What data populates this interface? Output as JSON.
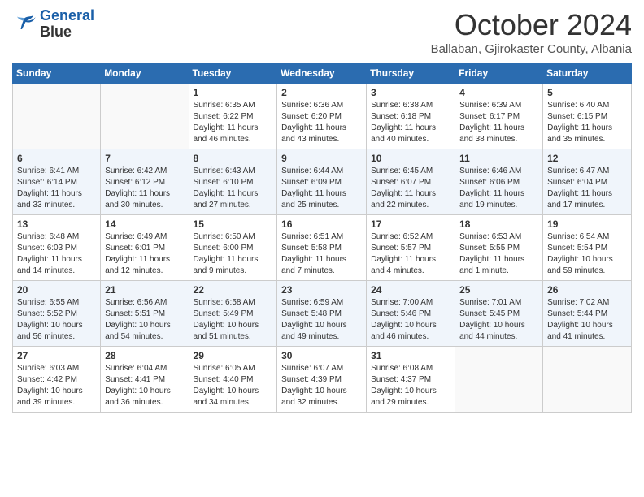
{
  "logo": {
    "line1": "General",
    "line2": "Blue"
  },
  "title": "October 2024",
  "subtitle": "Ballaban, Gjirokaster County, Albania",
  "days_of_week": [
    "Sunday",
    "Monday",
    "Tuesday",
    "Wednesday",
    "Thursday",
    "Friday",
    "Saturday"
  ],
  "weeks": [
    [
      {
        "day": "",
        "info": ""
      },
      {
        "day": "",
        "info": ""
      },
      {
        "day": "1",
        "info": "Sunrise: 6:35 AM\nSunset: 6:22 PM\nDaylight: 11 hours and 46 minutes."
      },
      {
        "day": "2",
        "info": "Sunrise: 6:36 AM\nSunset: 6:20 PM\nDaylight: 11 hours and 43 minutes."
      },
      {
        "day": "3",
        "info": "Sunrise: 6:38 AM\nSunset: 6:18 PM\nDaylight: 11 hours and 40 minutes."
      },
      {
        "day": "4",
        "info": "Sunrise: 6:39 AM\nSunset: 6:17 PM\nDaylight: 11 hours and 38 minutes."
      },
      {
        "day": "5",
        "info": "Sunrise: 6:40 AM\nSunset: 6:15 PM\nDaylight: 11 hours and 35 minutes."
      }
    ],
    [
      {
        "day": "6",
        "info": "Sunrise: 6:41 AM\nSunset: 6:14 PM\nDaylight: 11 hours and 33 minutes."
      },
      {
        "day": "7",
        "info": "Sunrise: 6:42 AM\nSunset: 6:12 PM\nDaylight: 11 hours and 30 minutes."
      },
      {
        "day": "8",
        "info": "Sunrise: 6:43 AM\nSunset: 6:10 PM\nDaylight: 11 hours and 27 minutes."
      },
      {
        "day": "9",
        "info": "Sunrise: 6:44 AM\nSunset: 6:09 PM\nDaylight: 11 hours and 25 minutes."
      },
      {
        "day": "10",
        "info": "Sunrise: 6:45 AM\nSunset: 6:07 PM\nDaylight: 11 hours and 22 minutes."
      },
      {
        "day": "11",
        "info": "Sunrise: 6:46 AM\nSunset: 6:06 PM\nDaylight: 11 hours and 19 minutes."
      },
      {
        "day": "12",
        "info": "Sunrise: 6:47 AM\nSunset: 6:04 PM\nDaylight: 11 hours and 17 minutes."
      }
    ],
    [
      {
        "day": "13",
        "info": "Sunrise: 6:48 AM\nSunset: 6:03 PM\nDaylight: 11 hours and 14 minutes."
      },
      {
        "day": "14",
        "info": "Sunrise: 6:49 AM\nSunset: 6:01 PM\nDaylight: 11 hours and 12 minutes."
      },
      {
        "day": "15",
        "info": "Sunrise: 6:50 AM\nSunset: 6:00 PM\nDaylight: 11 hours and 9 minutes."
      },
      {
        "day": "16",
        "info": "Sunrise: 6:51 AM\nSunset: 5:58 PM\nDaylight: 11 hours and 7 minutes."
      },
      {
        "day": "17",
        "info": "Sunrise: 6:52 AM\nSunset: 5:57 PM\nDaylight: 11 hours and 4 minutes."
      },
      {
        "day": "18",
        "info": "Sunrise: 6:53 AM\nSunset: 5:55 PM\nDaylight: 11 hours and 1 minute."
      },
      {
        "day": "19",
        "info": "Sunrise: 6:54 AM\nSunset: 5:54 PM\nDaylight: 10 hours and 59 minutes."
      }
    ],
    [
      {
        "day": "20",
        "info": "Sunrise: 6:55 AM\nSunset: 5:52 PM\nDaylight: 10 hours and 56 minutes."
      },
      {
        "day": "21",
        "info": "Sunrise: 6:56 AM\nSunset: 5:51 PM\nDaylight: 10 hours and 54 minutes."
      },
      {
        "day": "22",
        "info": "Sunrise: 6:58 AM\nSunset: 5:49 PM\nDaylight: 10 hours and 51 minutes."
      },
      {
        "day": "23",
        "info": "Sunrise: 6:59 AM\nSunset: 5:48 PM\nDaylight: 10 hours and 49 minutes."
      },
      {
        "day": "24",
        "info": "Sunrise: 7:00 AM\nSunset: 5:46 PM\nDaylight: 10 hours and 46 minutes."
      },
      {
        "day": "25",
        "info": "Sunrise: 7:01 AM\nSunset: 5:45 PM\nDaylight: 10 hours and 44 minutes."
      },
      {
        "day": "26",
        "info": "Sunrise: 7:02 AM\nSunset: 5:44 PM\nDaylight: 10 hours and 41 minutes."
      }
    ],
    [
      {
        "day": "27",
        "info": "Sunrise: 6:03 AM\nSunset: 4:42 PM\nDaylight: 10 hours and 39 minutes."
      },
      {
        "day": "28",
        "info": "Sunrise: 6:04 AM\nSunset: 4:41 PM\nDaylight: 10 hours and 36 minutes."
      },
      {
        "day": "29",
        "info": "Sunrise: 6:05 AM\nSunset: 4:40 PM\nDaylight: 10 hours and 34 minutes."
      },
      {
        "day": "30",
        "info": "Sunrise: 6:07 AM\nSunset: 4:39 PM\nDaylight: 10 hours and 32 minutes."
      },
      {
        "day": "31",
        "info": "Sunrise: 6:08 AM\nSunset: 4:37 PM\nDaylight: 10 hours and 29 minutes."
      },
      {
        "day": "",
        "info": ""
      },
      {
        "day": "",
        "info": ""
      }
    ]
  ]
}
